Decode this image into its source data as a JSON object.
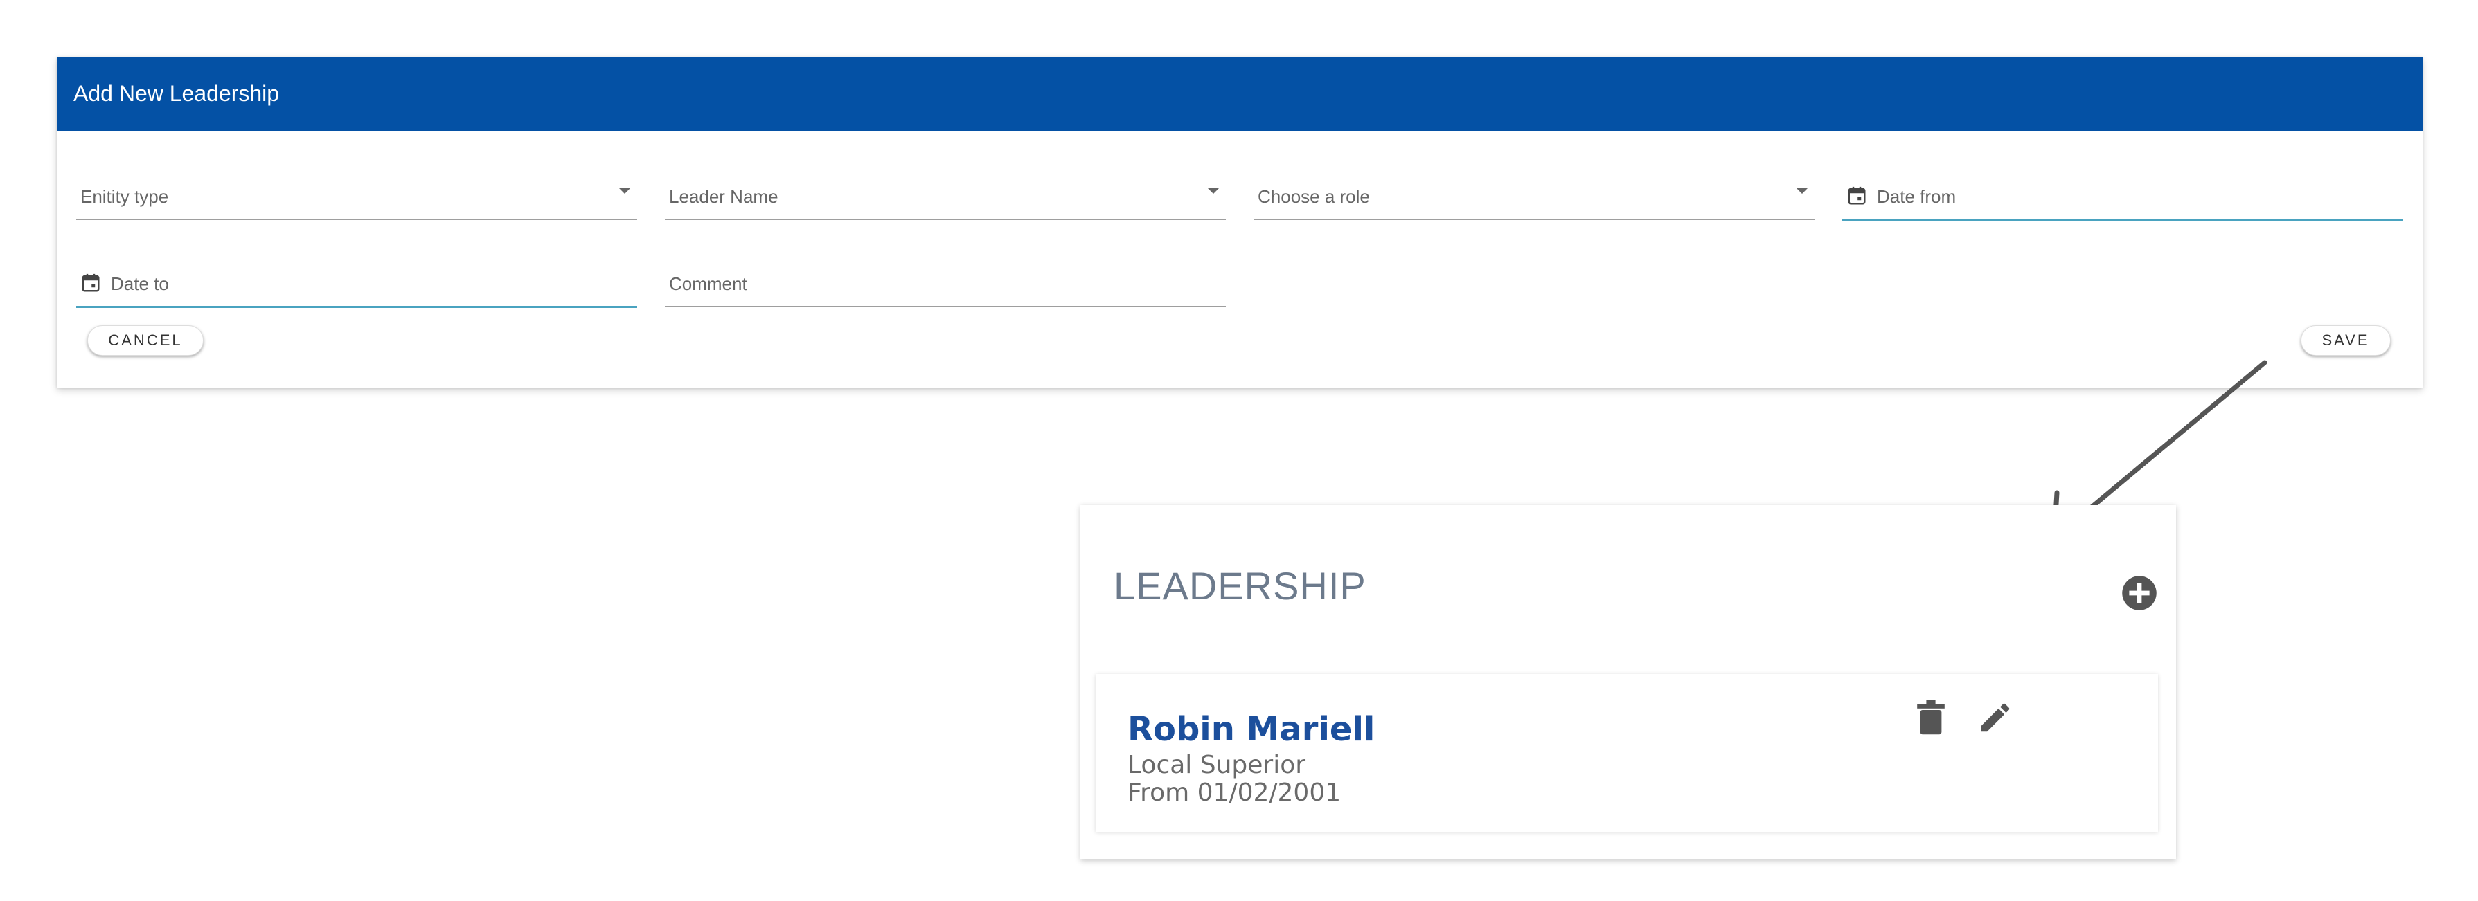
{
  "dialog": {
    "title": "Add New Leadership",
    "header_color": "#0451a5",
    "fields": {
      "entity_type": {
        "label": "Enitity type",
        "type": "select"
      },
      "leader_name": {
        "label": "Leader Name",
        "type": "select"
      },
      "role": {
        "label": "Choose a role",
        "type": "select"
      },
      "date_from": {
        "label": "Date from",
        "type": "date",
        "icon": "calendar-icon"
      },
      "date_to": {
        "label": "Date to",
        "type": "date",
        "icon": "calendar-icon"
      },
      "comment": {
        "label": "Comment",
        "type": "text"
      }
    },
    "cancel_label": "CANCEL",
    "save_label": "SAVE"
  },
  "card": {
    "title": "LEADERSHIP",
    "add_icon": "plus-circle-icon",
    "entries": [
      {
        "name": "Robin Mariell",
        "role": "Local Superior",
        "date": "From 01/02/2001",
        "actions": [
          "trash-icon",
          "edit-icon"
        ]
      }
    ]
  },
  "colors": {
    "accent": "#0451a5",
    "name_color": "#1c4f9c",
    "active_underline": "#4aa3c0"
  }
}
